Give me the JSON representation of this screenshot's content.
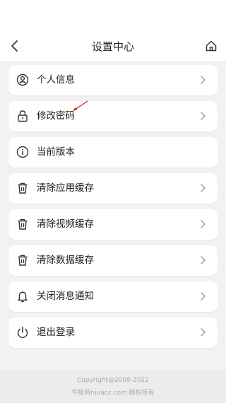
{
  "header": {
    "title": "设置中心",
    "back_icon": "chevron-left-icon",
    "home_icon": "home-icon"
  },
  "settings": {
    "items": [
      {
        "label": "个人信息",
        "icon": "user-circle-icon"
      },
      {
        "label": "修改密码",
        "icon": "lock-icon"
      },
      {
        "label": "当前版本",
        "icon": "info-circle-icon"
      },
      {
        "label": "清除应用缓存",
        "icon": "trash-icon"
      },
      {
        "label": "清除视频缓存",
        "icon": "trash-icon"
      },
      {
        "label": "清除数据缓存",
        "icon": "trash-icon"
      },
      {
        "label": "关闭消息通知",
        "icon": "bell-icon"
      },
      {
        "label": "退出登录",
        "icon": "power-icon"
      }
    ]
  },
  "footer": {
    "copyright": "Copyright@2009-2022",
    "owner": "牛账网niuacc.com 版权所有"
  },
  "colors": {
    "background": "#f2f2f2",
    "card": "#ffffff",
    "annotation_arrow": "#e02020",
    "footer_text": "#aaaaaa"
  }
}
